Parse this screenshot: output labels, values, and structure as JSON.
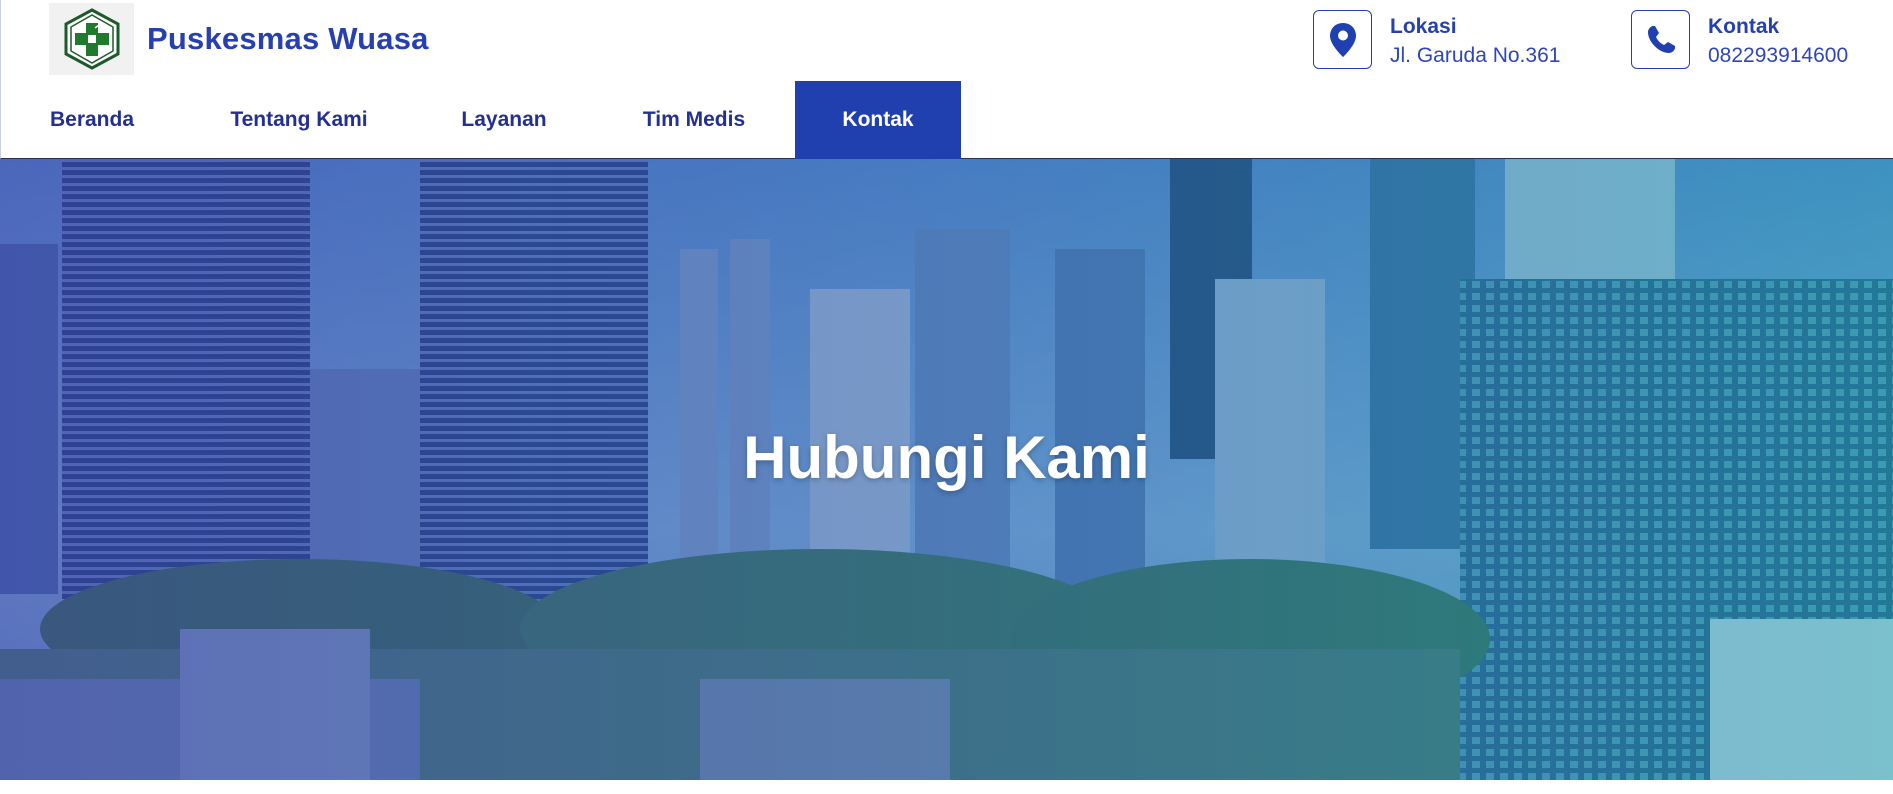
{
  "brand": {
    "name": "Puskesmas Wuasa",
    "logo_icon": "puskesmas-cross-logo-icon"
  },
  "contacts": [
    {
      "title": "Lokasi",
      "value": "Jl. Garuda No.361",
      "icon": "map-pin-icon"
    },
    {
      "title": "Kontak",
      "value": "082293914600",
      "icon": "phone-icon"
    }
  ],
  "nav": {
    "items": [
      {
        "label": "Beranda",
        "active": false
      },
      {
        "label": "Tentang Kami",
        "active": false
      },
      {
        "label": "Layanan",
        "active": false
      },
      {
        "label": "Tim Medis",
        "active": false
      },
      {
        "label": "Kontak",
        "active": true
      }
    ]
  },
  "hero": {
    "title": "Hubungi Kami",
    "background": "city-skyline-image"
  },
  "colors": {
    "primary": "#2140b0",
    "brand_text": "#2740b0",
    "nav_text": "#23308f"
  }
}
